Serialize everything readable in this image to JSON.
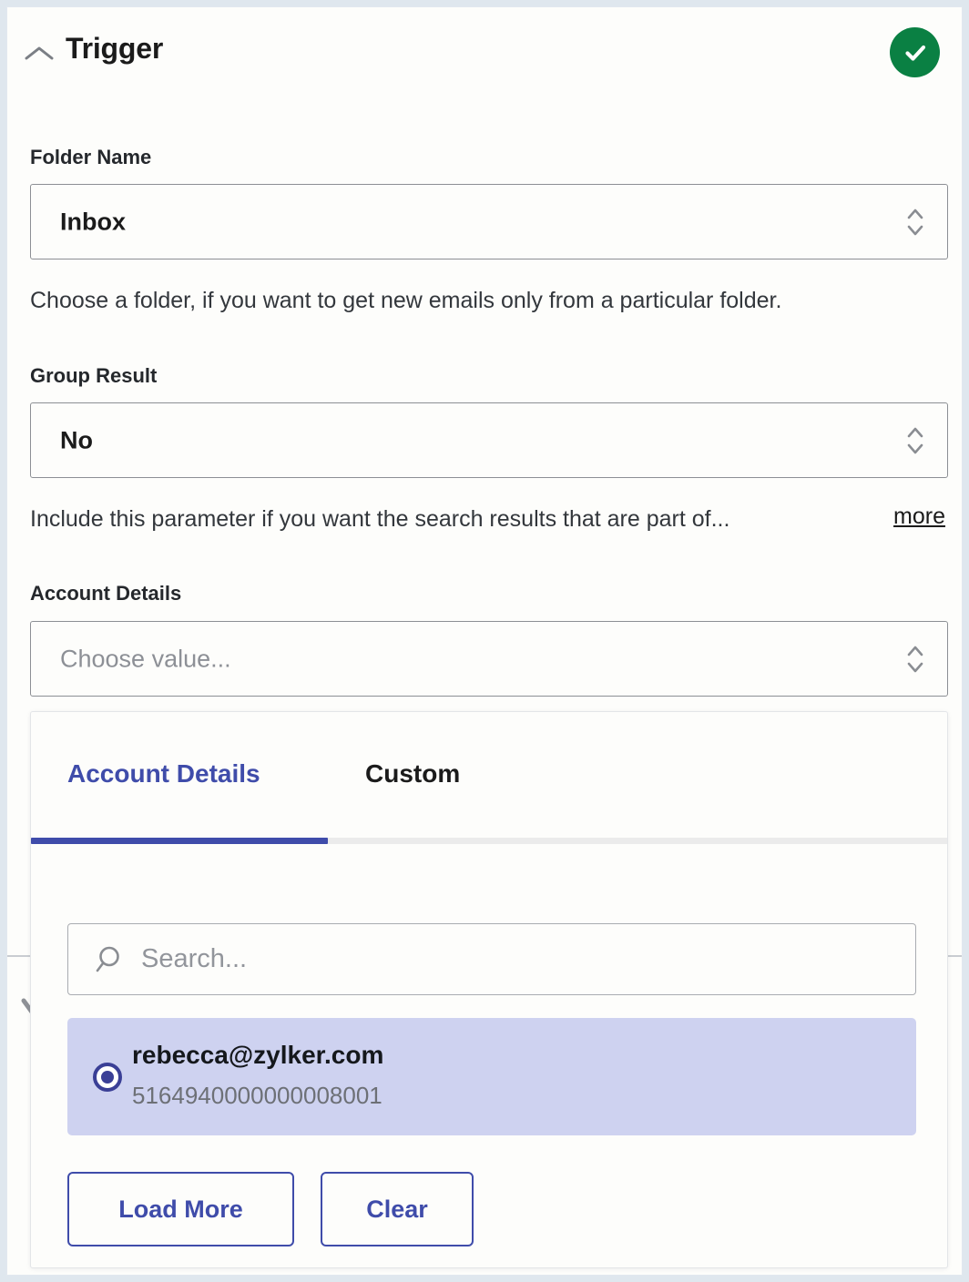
{
  "header": {
    "title": "Trigger",
    "collapse_icon": "chevron-up-icon",
    "status_icon": "check-circle-icon",
    "status_color": "#0a8043"
  },
  "fields": [
    {
      "label": "Folder Name",
      "value": "Inbox",
      "is_placeholder": false,
      "help": "Choose a folder, if you want to get new emails only from a particular folder.",
      "more_label": "",
      "stepper_icon": "chevron-up-down-icon"
    },
    {
      "label": "Group Result",
      "value": "No",
      "is_placeholder": false,
      "help": "Include this parameter if you want the search results that are part of...",
      "more_label": "more",
      "stepper_icon": "chevron-up-down-icon"
    },
    {
      "label": "Account Details",
      "value": "Choose value...",
      "is_placeholder": true,
      "help": "",
      "more_label": "",
      "stepper_icon": "chevron-up-down-icon"
    }
  ],
  "dropdown": {
    "tabs": [
      {
        "label": "Account Details",
        "active": true
      },
      {
        "label": "Custom",
        "active": false
      }
    ],
    "accent_color": "#3f4caa",
    "search": {
      "placeholder": "Search...",
      "value": "",
      "icon": "search-icon"
    },
    "results": [
      {
        "title": "rebecca@zylker.com",
        "subtitle": "5164940000000008001",
        "selected": true,
        "radio_icon": "radio-selected-icon"
      }
    ],
    "buttons": [
      {
        "label": "Load More"
      },
      {
        "label": "Clear"
      }
    ]
  }
}
